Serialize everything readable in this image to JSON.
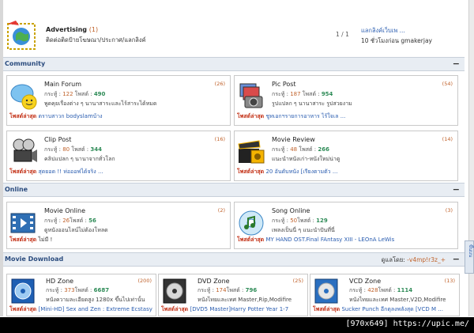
{
  "advertising": {
    "title": "Advertising",
    "count": "(1)",
    "desc": "ติดต่อติดป้ายโฆษณา/ประกาศ/แลกลิงค์",
    "page": "1 / 1",
    "last_title": "แลกลิงค์เว็บเพ ...",
    "last_meta": "10 ชั่วโมงก่อน gmakerjay"
  },
  "sections": {
    "community": {
      "title": "Community",
      "toggle": "−"
    },
    "online": {
      "title": "Online",
      "toggle": "−"
    },
    "movie_download": {
      "title": "Movie Download",
      "toggle": "−",
      "mod_label": "ดูแลโดย: ",
      "mod_name": "-v4mp!r3z_+"
    }
  },
  "labels": {
    "topics_prefix": "กระทู้ : ",
    "posts_prefix": "โพสต์ : ",
    "latest_label": "โพสต์ล่าสุด"
  },
  "community": [
    {
      "name": "Main Forum",
      "count": "(26)",
      "topics": "122",
      "posts": "490",
      "desc": "พูดคุยเรื่องต่าง ๆ นานาสาระและไร้สาระได้หมด",
      "latest": "ตราบสาวก bodyslamบ้าง"
    },
    {
      "name": "Pic Post",
      "count": "(54)",
      "topics": "187",
      "posts": "954",
      "desc": "รูปแปลก ๆ นานาสาระ รูปสวยงาม",
      "latest": "ชูทเอกฯรายการอาหาร ไร้ใจเล ..."
    },
    {
      "name": "Clip Post",
      "count": "(16)",
      "topics": "80",
      "posts": "344",
      "desc": "คลิปแปลก ๆ นานาจากทั่วโลก",
      "latest": "สุดยอด !! ห่อออฟได้จริง ..."
    },
    {
      "name": "Movie Review",
      "count": "(14)",
      "topics": "48",
      "posts": "266",
      "desc": "แนะนำหนังเก่า-หนังใหม่น่าดู",
      "latest": "20 อันดับหนัง [เรียงตามตัว ..."
    }
  ],
  "online": [
    {
      "name": "Movie Online",
      "count": "(2)",
      "topics": "26",
      "posts": "56",
      "desc": "ดูหนังออนไลน์ไม่ต้องโหลด",
      "latest": "ไม่มี !"
    },
    {
      "name": "Song Online",
      "count": "(3)",
      "topics": "50",
      "posts": "129",
      "desc": "เพลงเป็นนี่ ๆ แนะนำปันที่นี่",
      "latest": "MY HAND OST.Final FAntasy XIII - LEOnA LeWis"
    }
  ],
  "movie_download": [
    {
      "name": "HD Zone",
      "count": "(200)",
      "topics": "373",
      "posts": "6687",
      "desc": "หนังความละเอียดสูง 1280x ขึ้นไปเท่านั้น",
      "latest": "[Mini-HD] Sex and Zen : Extreme Ecstasy :"
    },
    {
      "name": "DVD Zone",
      "count": "(25)",
      "topics": "174",
      "posts": "796",
      "desc": "หนังไทยและเทศ Master,Rip,Modifire",
      "latest": "[DVD5 Master]Harry Potter Year 1-7"
    },
    {
      "name": "VCD Zone",
      "count": "(13)",
      "topics": "428",
      "posts": "1114",
      "desc": "หนังไทยและเทศ Master,V2D,Modifire",
      "latest": "Sucker Punch อีกตุลงพลังสุด [VCD M ..."
    }
  ],
  "side_tab": "ขึ้นบน",
  "watermark": "[970x649] https://upic.me/"
}
